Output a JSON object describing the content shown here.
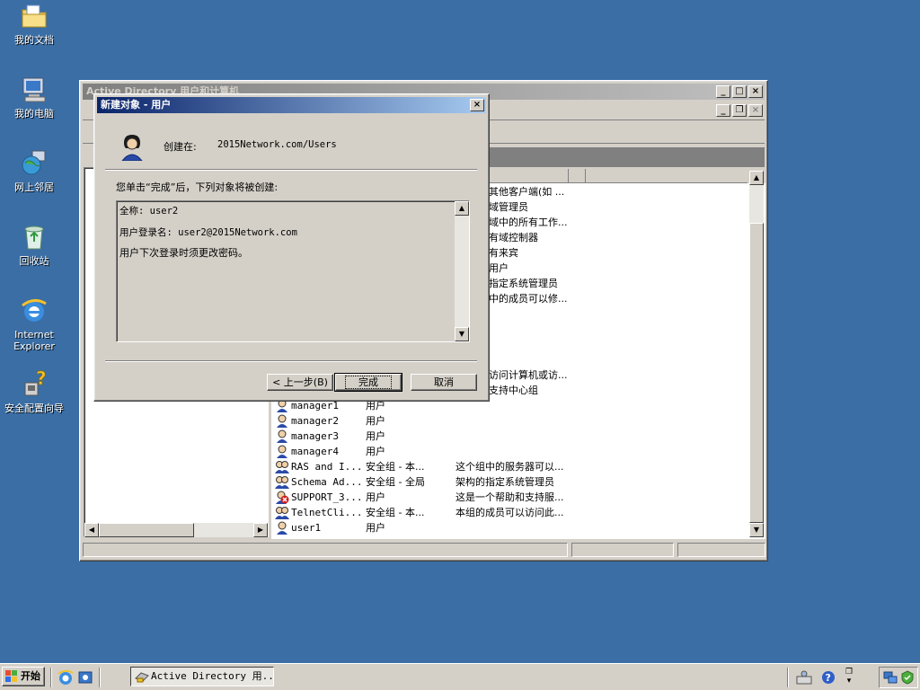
{
  "desktop": {
    "icons": [
      {
        "label": "我的文档"
      },
      {
        "label": "我的电脑"
      },
      {
        "label": "网上邻居"
      },
      {
        "label": "回收站"
      },
      {
        "label": "Internet\nExplorer"
      },
      {
        "label": "安全配置向导"
      }
    ]
  },
  "main_window": {
    "title": "Active Directory 用户和计算机",
    "groups_desc": [
      "其他客户端(如 ...",
      "域管理员",
      "域中的所有工作...",
      "有域控制器",
      "有来宾",
      "用户",
      "指定系统管理员",
      "中的成员可以修..."
    ],
    "groups_desc_2": [
      "访问计算机或访...",
      "支持中心组"
    ],
    "rows": [
      {
        "name": "manager1",
        "type": "用户",
        "desc": ""
      },
      {
        "name": "manager2",
        "type": "用户",
        "desc": ""
      },
      {
        "name": "manager3",
        "type": "用户",
        "desc": ""
      },
      {
        "name": "manager4",
        "type": "用户",
        "desc": ""
      },
      {
        "name": "RAS and I...",
        "type": "安全组 - 本...",
        "desc": "这个组中的服务器可以..."
      },
      {
        "name": "Schema Ad...",
        "type": "安全组 - 全局",
        "desc": "架构的指定系统管理员"
      },
      {
        "name": "SUPPORT_3...",
        "type": "用户",
        "desc": "这是一个帮助和支持服..."
      },
      {
        "name": "TelnetCli...",
        "type": "安全组 - 本...",
        "desc": "本组的成员可以访问此..."
      },
      {
        "name": "user1",
        "type": "用户",
        "desc": ""
      }
    ]
  },
  "dialog": {
    "title": "新建对象 - 用户",
    "created_in_label": "创建在:",
    "created_in_path": "2015Network.com/Users",
    "instruction": "您单击“完成”后，下列对象将被创建:",
    "summary": [
      "全称: user2",
      "用户登录名: user2@2015Network.com",
      "用户下次登录时须更改密码。"
    ],
    "back_button": "< 上一步(B)",
    "finish_button": "完成",
    "cancel_button": "取消"
  },
  "taskbar": {
    "start_label": "开始",
    "task_label": "Active Directory 用..."
  }
}
